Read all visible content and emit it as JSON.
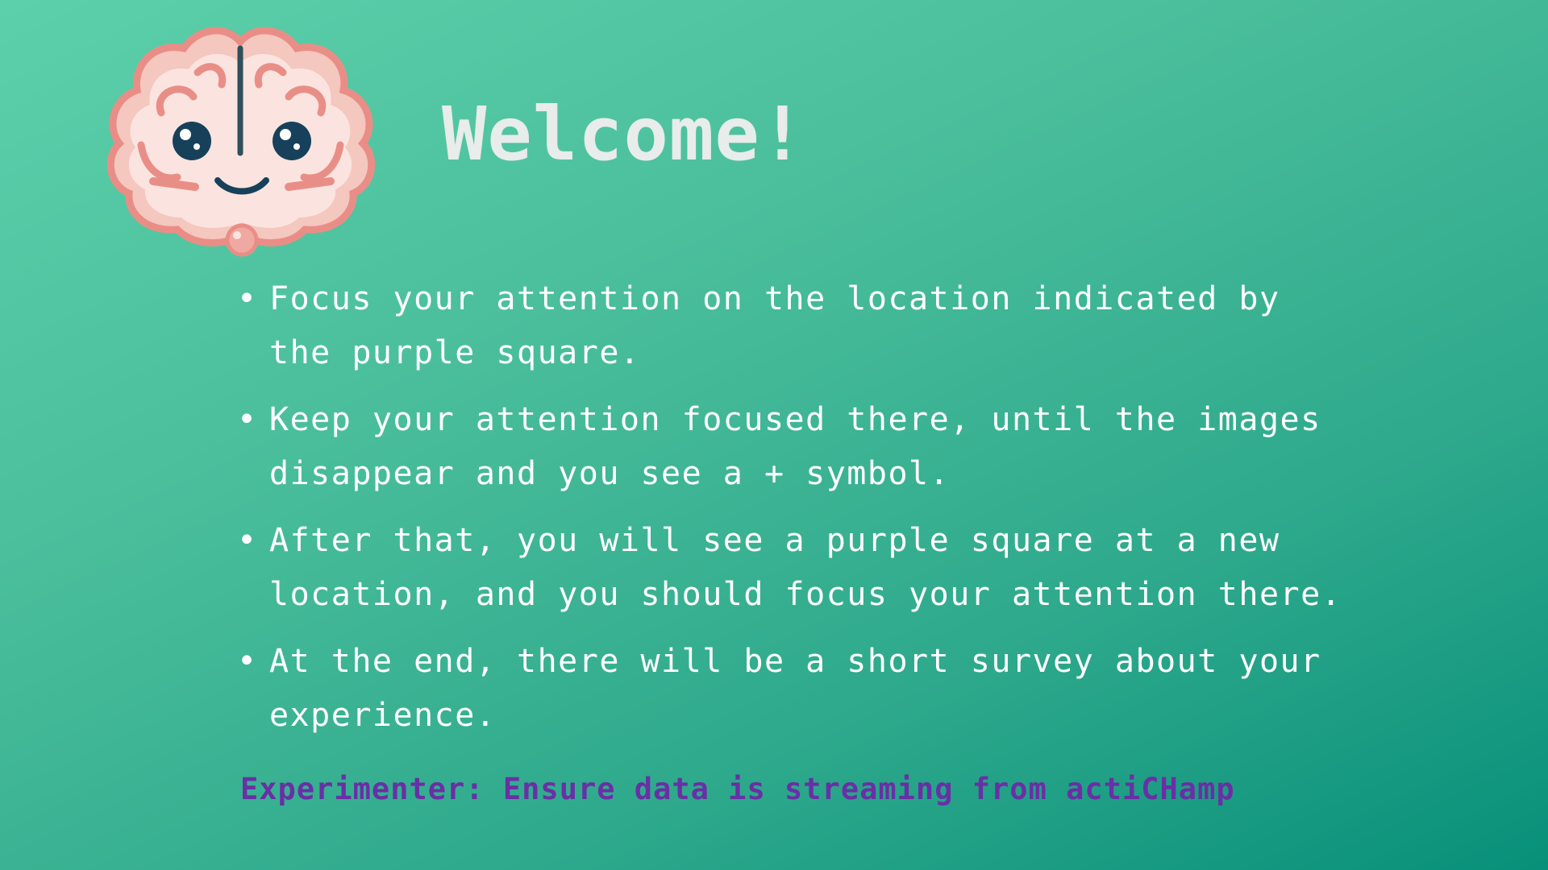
{
  "header": {
    "logo_icon": "cartoon-brain-icon",
    "title": "Welcome!"
  },
  "instructions": {
    "bullet": "•",
    "items": [
      {
        "text": "Focus your attention on the location indicated by the purple square."
      },
      {
        "text": "Keep your attention focused there, until the images disappear and you see a + symbol."
      },
      {
        "text": "After that, you will see a purple square at a new location, and you should focus your attention there."
      },
      {
        "text": "At the end, there will be a short survey about your experience."
      }
    ]
  },
  "footer": {
    "experimenter_note": "Experimenter: Ensure data is streaming from actiCHamp"
  },
  "colors": {
    "background_start": "#5cd0aa",
    "background_end": "#08907a",
    "title": "#e8ecea",
    "body_text": "#ffffff",
    "note_text": "#6a2fa6"
  }
}
